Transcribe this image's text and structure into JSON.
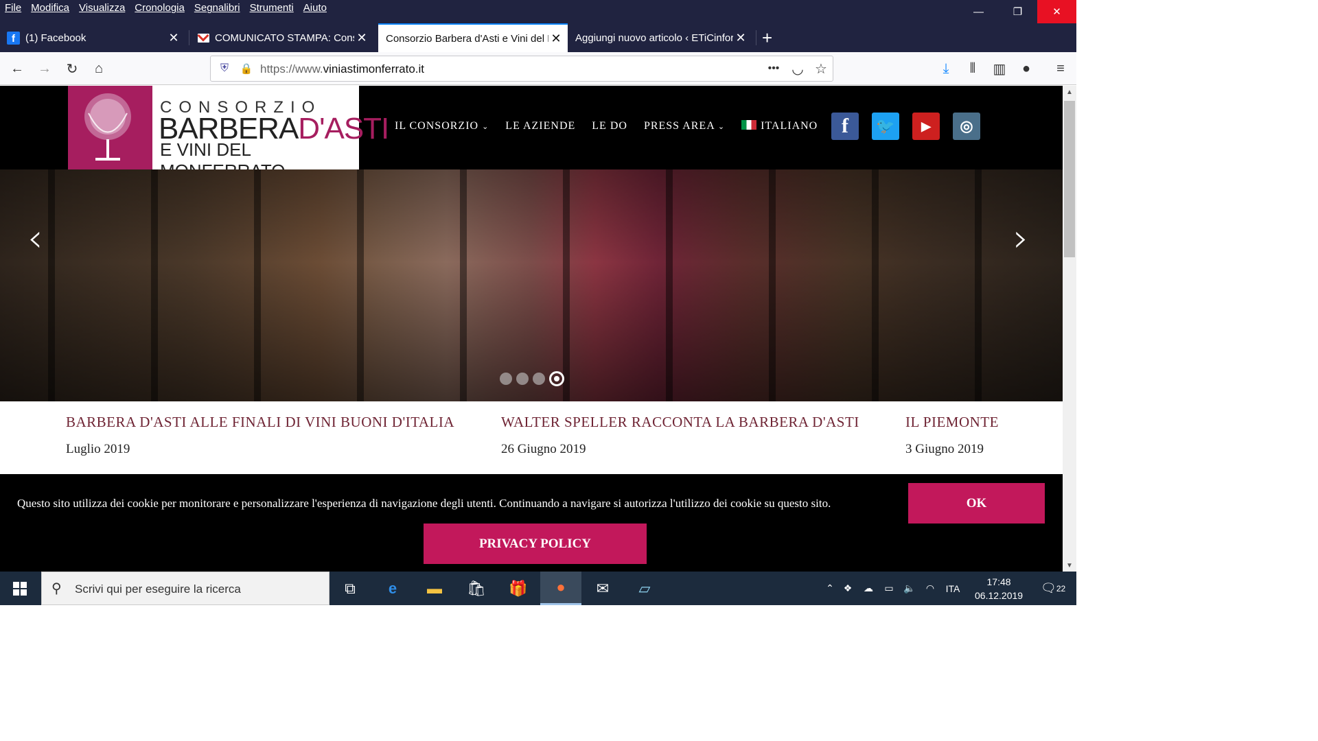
{
  "menu_bar": {
    "items": [
      "File",
      "Modifica",
      "Visualizza",
      "Cronologia",
      "Segnalibri",
      "Strumenti",
      "Aiuto"
    ]
  },
  "tabs": [
    {
      "label": "(1) Facebook",
      "active": false
    },
    {
      "label": "COMUNICATO STAMPA: Consorzio",
      "active": false
    },
    {
      "label": "Consorzio Barbera d'Asti e Vini del Monferrato",
      "active": true
    },
    {
      "label": "Aggiungi nuovo articolo ‹ ETiCinform",
      "active": false
    }
  ],
  "url": {
    "prefix": "https://www.",
    "domain": "viniastimonferrato.it"
  },
  "site": {
    "logo": {
      "line1": "CONSORZIO",
      "line2a": "BARBERA",
      "line2b": "D'ASTI",
      "line3": "E VINI DEL MONFERRATO"
    },
    "nav": [
      "IL CONSORZIO",
      "LE AZIENDE",
      "LE DO",
      "PRESS AREA",
      "ITALIANO"
    ],
    "social": [
      {
        "name": "facebook",
        "glyph": "f",
        "color": "#3b5998"
      },
      {
        "name": "twitter",
        "glyph": "t",
        "color": "#1da1f2"
      },
      {
        "name": "youtube",
        "glyph": "▶",
        "color": "#cd201f"
      },
      {
        "name": "instagram",
        "glyph": "◎",
        "color": "#4a6f8a"
      }
    ]
  },
  "slider": {
    "slide_count": 4,
    "active_index": 4
  },
  "news": [
    {
      "title": "BARBERA D'ASTI ALLE FINALI DI VINI BUONI D'ITALIA",
      "date": "Luglio 2019"
    },
    {
      "title": "WALTER SPELLER RACCONTA LA BARBERA D'ASTI",
      "date": "26 Giugno 2019"
    },
    {
      "title": "IL PIEMONTE",
      "date": "3 Giugno 2019"
    }
  ],
  "cookie_bar": {
    "text": "Questo sito utilizza dei cookie per monitorare e personalizzare l'esperienza di navigazione degli utenti. Continuando a navigare si autorizza l'utilizzo dei cookie su questo sito.",
    "ok_label": "OK",
    "privacy_label": "PRIVACY POLICY"
  },
  "taskbar": {
    "search_placeholder": "Scrivi qui per eseguire la ricerca",
    "language": "ITA",
    "time": "17:48",
    "date": "06.12.2019",
    "notifications": "22"
  }
}
